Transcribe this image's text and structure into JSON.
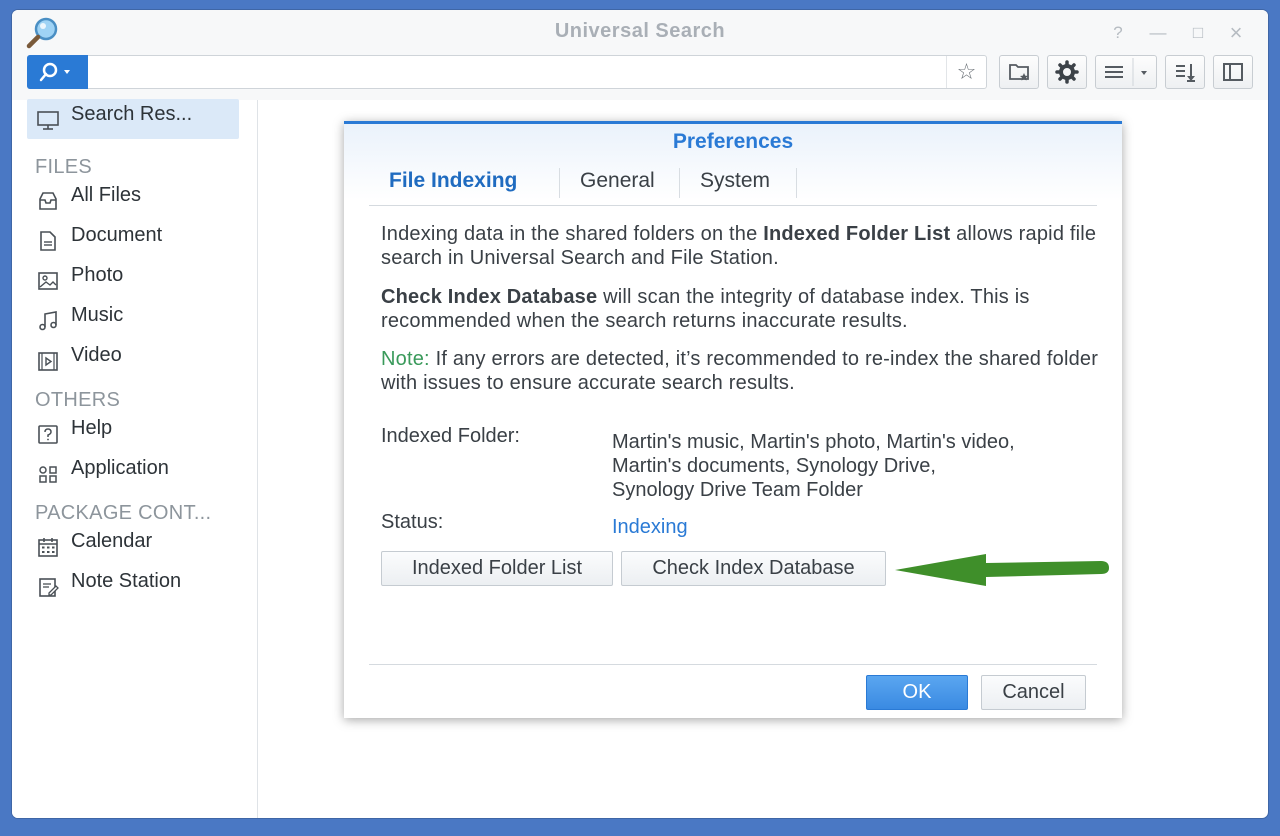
{
  "window": {
    "title": "Universal Search",
    "controls": {
      "help": "?",
      "minimize": "—",
      "maximize": "□",
      "close": "×"
    }
  },
  "toolbar": {
    "search_placeholder": "",
    "star_glyph": "☆"
  },
  "sidebar": {
    "active_item": "Search Res...",
    "sections": {
      "files": "FILES",
      "others": "OTHERS",
      "package": "PACKAGE CONT..."
    },
    "files_items": [
      {
        "label": "All Files",
        "icon": "inbox-icon"
      },
      {
        "label": "Document",
        "icon": "document-icon"
      },
      {
        "label": "Photo",
        "icon": "photo-icon"
      },
      {
        "label": "Music",
        "icon": "music-note-icon"
      },
      {
        "label": "Video",
        "icon": "video-icon"
      }
    ],
    "others_items": [
      {
        "label": "Help",
        "icon": "help-icon"
      },
      {
        "label": "Application",
        "icon": "apps-grid-icon"
      }
    ],
    "package_items": [
      {
        "label": "Calendar",
        "icon": "calendar-icon"
      },
      {
        "label": "Note Station",
        "icon": "note-icon"
      }
    ]
  },
  "dialog": {
    "title": "Preferences",
    "tabs": [
      {
        "label": "File Indexing",
        "active": true
      },
      {
        "label": "General",
        "active": false
      },
      {
        "label": "System",
        "active": false
      }
    ],
    "para1_pre": "Indexing data in the shared folders on the ",
    "para1_bold": "Indexed Folder List",
    "para1_post": " allows rapid file search in Universal Search and File Station.",
    "para2_bold": "Check Index Database",
    "para2_post": " will scan the integrity of database index. This is recommended when the search returns inaccurate results.",
    "note_label": "Note:",
    "note_text": " If any errors are detected, it’s recommended to re-index the shared folder with issues to ensure accurate search results.",
    "indexed_folder_label": "Indexed Folder:",
    "indexed_folder_value_line1": "Martin's music, Martin's photo, Martin's video,",
    "indexed_folder_value_line2": "Martin's documents, Synology Drive,",
    "indexed_folder_value_line3": "Synology Drive Team Folder",
    "status_label": "Status:",
    "status_value": "Indexing",
    "btn_indexed_folder_list": "Indexed Folder List",
    "btn_check_index_db": "Check Index Database",
    "btn_ok": "OK",
    "btn_cancel": "Cancel"
  },
  "colors": {
    "accent": "#2a7ad5",
    "note_green": "#3a9a5b",
    "arrow_green": "#3f8f2a",
    "desktop_bg": "#4a78c4"
  }
}
